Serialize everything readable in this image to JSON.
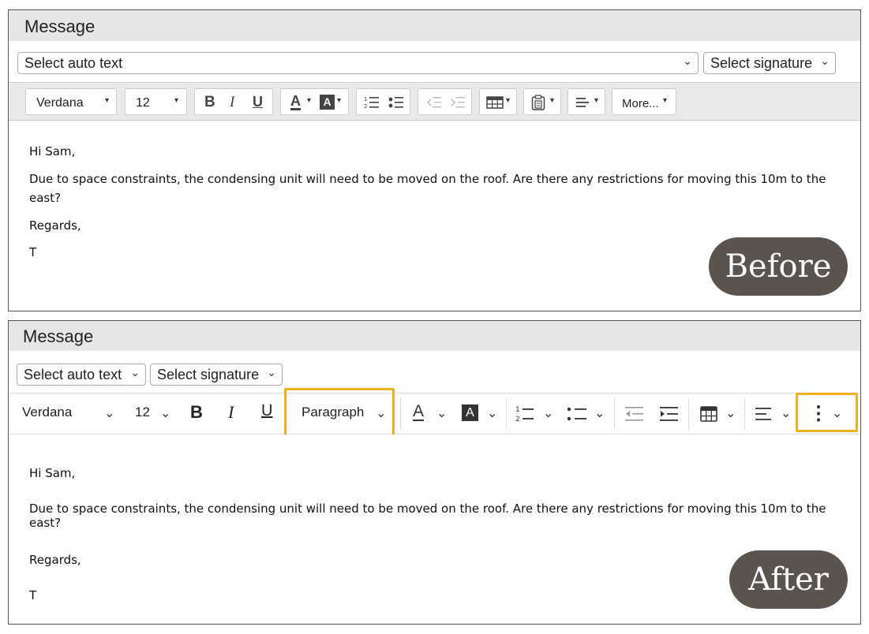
{
  "before": {
    "header": "Message",
    "auto_text": "Select auto text",
    "signature": "Select signature",
    "chevron": "⌄",
    "toolbar": {
      "font": "Verdana",
      "size": "12",
      "bold": "B",
      "italic": "I",
      "underline": "U",
      "more": "More...",
      "caret": "▾"
    },
    "body": [
      "Hi Sam,",
      "Due to space constraints, the condensing unit will need to be moved on the roof. Are there any restrictions for moving this 10m to the east?",
      "Regards,",
      "T"
    ],
    "label": "Before"
  },
  "after": {
    "header": "Message",
    "auto_text": "Select auto text",
    "signature": "Select signature",
    "chevron": "⌄",
    "toolbar": {
      "font": "Verdana",
      "size": "12",
      "bold": "B",
      "italic": "I",
      "underline": "U",
      "paragraph": "Paragraph",
      "more": "⋮",
      "chevron": "⌄"
    },
    "body": [
      "Hi Sam,",
      "Due to space constraints, the condensing unit will need to be moved on the roof. Are there any restrictions for moving this 10m to the east?",
      "Regards,",
      "T"
    ],
    "label": "After"
  },
  "colors": {
    "highlight": "#f2b01e",
    "label_bg": "#5a534e",
    "header_bg": "#e6e6e6"
  }
}
